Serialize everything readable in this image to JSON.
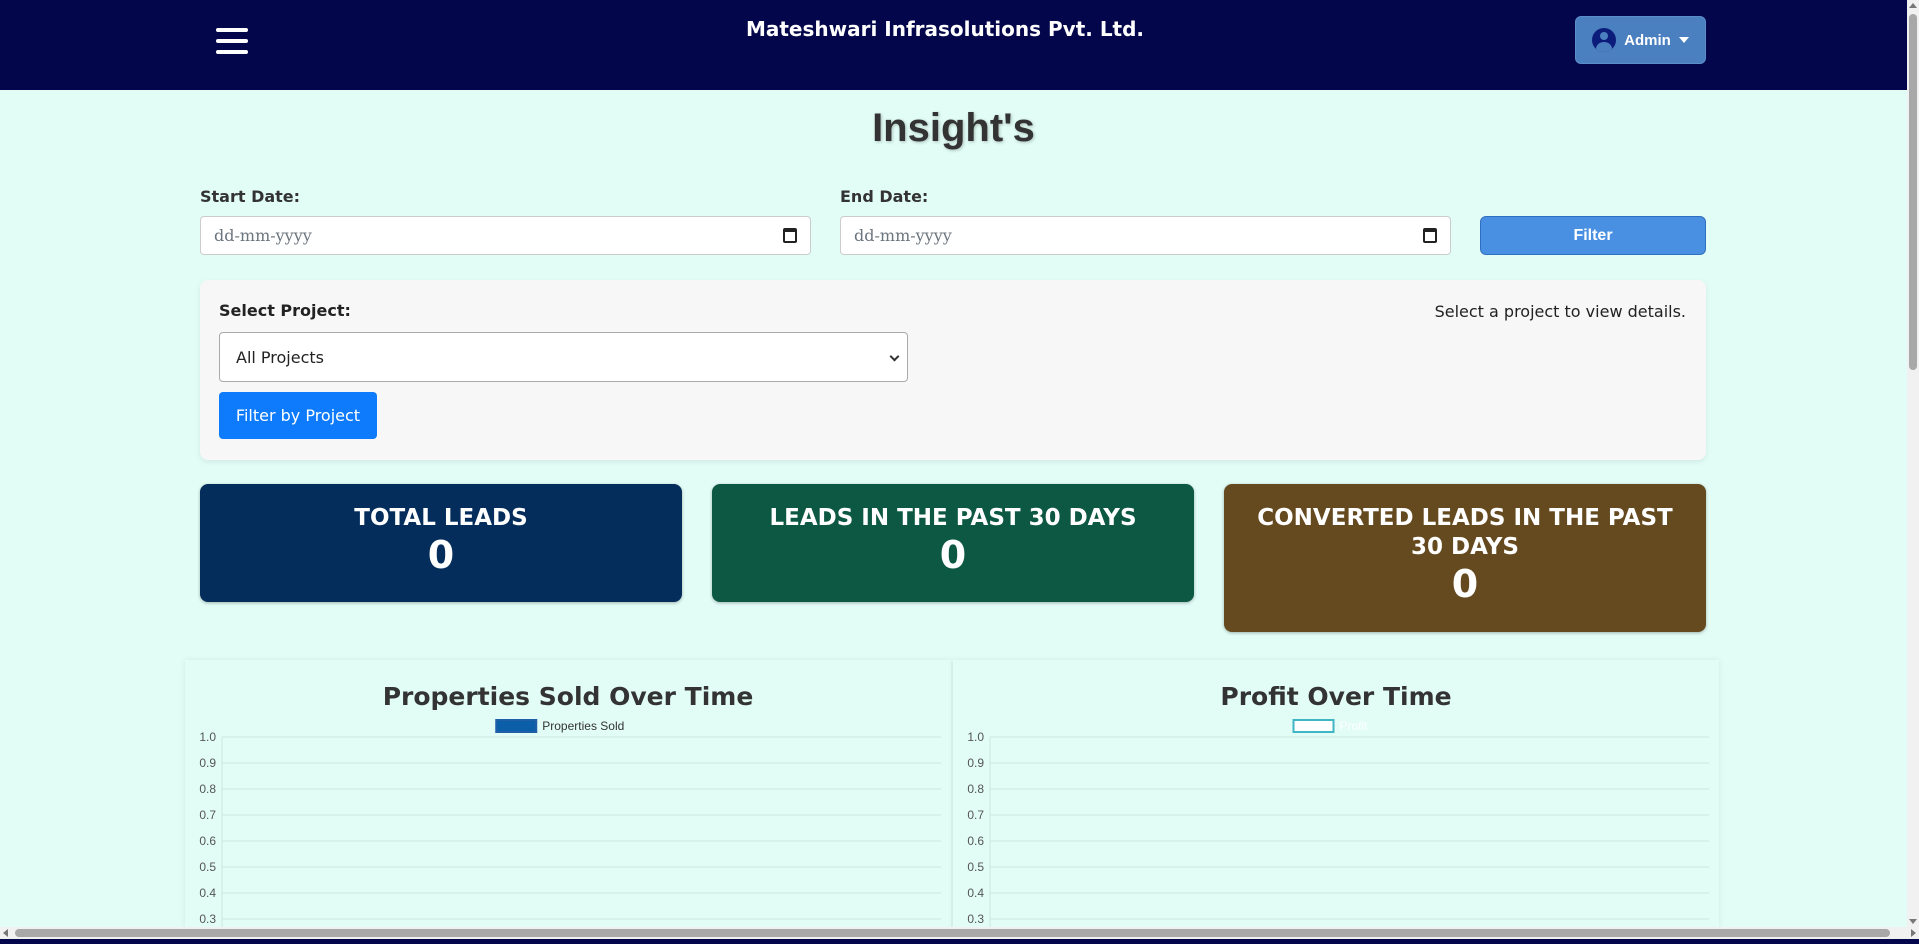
{
  "header": {
    "company_name": "Mateshwari Infrasolutions Pvt. Ltd.",
    "admin_label": "Admin",
    "menu_icon": "hamburger-icon",
    "avatar_icon": "user-circle-icon",
    "bg_color": "#03064a"
  },
  "page": {
    "title": "Insight's"
  },
  "date_filter": {
    "start_label": "Start Date:",
    "start_placeholder": "dd-mm-yyyy",
    "end_label": "End Date:",
    "end_placeholder": "dd-mm-yyyy",
    "filter_label": "Filter"
  },
  "project_filter": {
    "label": "Select Project:",
    "selected": "All Projects",
    "button_label": "Filter by Project",
    "hint": "Select a project to view details."
  },
  "stats": [
    {
      "label": "TOTAL LEADS",
      "value": "0",
      "color": "#042d5c"
    },
    {
      "label": "LEADS IN THE PAST 30 DAYS",
      "value": "0",
      "color": "#0d5843"
    },
    {
      "label": "CONVERTED LEADS IN THE PAST 30 DAYS",
      "value": "0",
      "color": "#654a1f"
    }
  ],
  "chart_data": [
    {
      "type": "bar",
      "title": "Properties Sold Over Time",
      "series": [
        {
          "name": "Properties Sold",
          "values": []
        }
      ],
      "categories": [],
      "ylim": [
        0,
        1
      ],
      "y_ticks": [
        "1.0",
        "0.9",
        "0.8",
        "0.7",
        "0.6",
        "0.5",
        "0.4",
        "0.3"
      ],
      "grid": true,
      "legend": "top",
      "legend_color": "#0a5fa8"
    },
    {
      "type": "line",
      "title": "Profit Over Time",
      "series": [
        {
          "name": "Profit",
          "values": []
        }
      ],
      "categories": [],
      "ylim": [
        0,
        1
      ],
      "y_ticks": [
        "1.0",
        "0.9",
        "0.8",
        "0.7",
        "0.6",
        "0.5",
        "0.4",
        "0.3"
      ],
      "grid": true,
      "legend": "top",
      "legend_color": "#3fb6c4"
    }
  ]
}
